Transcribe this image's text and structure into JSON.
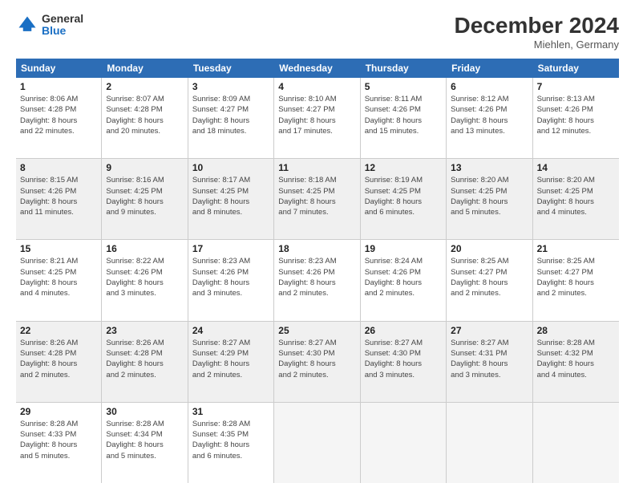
{
  "logo": {
    "general": "General",
    "blue": "Blue"
  },
  "header": {
    "month": "December 2024",
    "location": "Miehlen, Germany"
  },
  "weekdays": [
    "Sunday",
    "Monday",
    "Tuesday",
    "Wednesday",
    "Thursday",
    "Friday",
    "Saturday"
  ],
  "rows": [
    [
      {
        "day": "1",
        "lines": [
          "Sunrise: 8:06 AM",
          "Sunset: 4:28 PM",
          "Daylight: 8 hours",
          "and 22 minutes."
        ]
      },
      {
        "day": "2",
        "lines": [
          "Sunrise: 8:07 AM",
          "Sunset: 4:28 PM",
          "Daylight: 8 hours",
          "and 20 minutes."
        ]
      },
      {
        "day": "3",
        "lines": [
          "Sunrise: 8:09 AM",
          "Sunset: 4:27 PM",
          "Daylight: 8 hours",
          "and 18 minutes."
        ]
      },
      {
        "day": "4",
        "lines": [
          "Sunrise: 8:10 AM",
          "Sunset: 4:27 PM",
          "Daylight: 8 hours",
          "and 17 minutes."
        ]
      },
      {
        "day": "5",
        "lines": [
          "Sunrise: 8:11 AM",
          "Sunset: 4:26 PM",
          "Daylight: 8 hours",
          "and 15 minutes."
        ]
      },
      {
        "day": "6",
        "lines": [
          "Sunrise: 8:12 AM",
          "Sunset: 4:26 PM",
          "Daylight: 8 hours",
          "and 13 minutes."
        ]
      },
      {
        "day": "7",
        "lines": [
          "Sunrise: 8:13 AM",
          "Sunset: 4:26 PM",
          "Daylight: 8 hours",
          "and 12 minutes."
        ]
      }
    ],
    [
      {
        "day": "8",
        "lines": [
          "Sunrise: 8:15 AM",
          "Sunset: 4:26 PM",
          "Daylight: 8 hours",
          "and 11 minutes."
        ]
      },
      {
        "day": "9",
        "lines": [
          "Sunrise: 8:16 AM",
          "Sunset: 4:25 PM",
          "Daylight: 8 hours",
          "and 9 minutes."
        ]
      },
      {
        "day": "10",
        "lines": [
          "Sunrise: 8:17 AM",
          "Sunset: 4:25 PM",
          "Daylight: 8 hours",
          "and 8 minutes."
        ]
      },
      {
        "day": "11",
        "lines": [
          "Sunrise: 8:18 AM",
          "Sunset: 4:25 PM",
          "Daylight: 8 hours",
          "and 7 minutes."
        ]
      },
      {
        "day": "12",
        "lines": [
          "Sunrise: 8:19 AM",
          "Sunset: 4:25 PM",
          "Daylight: 8 hours",
          "and 6 minutes."
        ]
      },
      {
        "day": "13",
        "lines": [
          "Sunrise: 8:20 AM",
          "Sunset: 4:25 PM",
          "Daylight: 8 hours",
          "and 5 minutes."
        ]
      },
      {
        "day": "14",
        "lines": [
          "Sunrise: 8:20 AM",
          "Sunset: 4:25 PM",
          "Daylight: 8 hours",
          "and 4 minutes."
        ]
      }
    ],
    [
      {
        "day": "15",
        "lines": [
          "Sunrise: 8:21 AM",
          "Sunset: 4:25 PM",
          "Daylight: 8 hours",
          "and 4 minutes."
        ]
      },
      {
        "day": "16",
        "lines": [
          "Sunrise: 8:22 AM",
          "Sunset: 4:26 PM",
          "Daylight: 8 hours",
          "and 3 minutes."
        ]
      },
      {
        "day": "17",
        "lines": [
          "Sunrise: 8:23 AM",
          "Sunset: 4:26 PM",
          "Daylight: 8 hours",
          "and 3 minutes."
        ]
      },
      {
        "day": "18",
        "lines": [
          "Sunrise: 8:23 AM",
          "Sunset: 4:26 PM",
          "Daylight: 8 hours",
          "and 2 minutes."
        ]
      },
      {
        "day": "19",
        "lines": [
          "Sunrise: 8:24 AM",
          "Sunset: 4:26 PM",
          "Daylight: 8 hours",
          "and 2 minutes."
        ]
      },
      {
        "day": "20",
        "lines": [
          "Sunrise: 8:25 AM",
          "Sunset: 4:27 PM",
          "Daylight: 8 hours",
          "and 2 minutes."
        ]
      },
      {
        "day": "21",
        "lines": [
          "Sunrise: 8:25 AM",
          "Sunset: 4:27 PM",
          "Daylight: 8 hours",
          "and 2 minutes."
        ]
      }
    ],
    [
      {
        "day": "22",
        "lines": [
          "Sunrise: 8:26 AM",
          "Sunset: 4:28 PM",
          "Daylight: 8 hours",
          "and 2 minutes."
        ]
      },
      {
        "day": "23",
        "lines": [
          "Sunrise: 8:26 AM",
          "Sunset: 4:28 PM",
          "Daylight: 8 hours",
          "and 2 minutes."
        ]
      },
      {
        "day": "24",
        "lines": [
          "Sunrise: 8:27 AM",
          "Sunset: 4:29 PM",
          "Daylight: 8 hours",
          "and 2 minutes."
        ]
      },
      {
        "day": "25",
        "lines": [
          "Sunrise: 8:27 AM",
          "Sunset: 4:30 PM",
          "Daylight: 8 hours",
          "and 2 minutes."
        ]
      },
      {
        "day": "26",
        "lines": [
          "Sunrise: 8:27 AM",
          "Sunset: 4:30 PM",
          "Daylight: 8 hours",
          "and 3 minutes."
        ]
      },
      {
        "day": "27",
        "lines": [
          "Sunrise: 8:27 AM",
          "Sunset: 4:31 PM",
          "Daylight: 8 hours",
          "and 3 minutes."
        ]
      },
      {
        "day": "28",
        "lines": [
          "Sunrise: 8:28 AM",
          "Sunset: 4:32 PM",
          "Daylight: 8 hours",
          "and 4 minutes."
        ]
      }
    ],
    [
      {
        "day": "29",
        "lines": [
          "Sunrise: 8:28 AM",
          "Sunset: 4:33 PM",
          "Daylight: 8 hours",
          "and 5 minutes."
        ]
      },
      {
        "day": "30",
        "lines": [
          "Sunrise: 8:28 AM",
          "Sunset: 4:34 PM",
          "Daylight: 8 hours",
          "and 5 minutes."
        ]
      },
      {
        "day": "31",
        "lines": [
          "Sunrise: 8:28 AM",
          "Sunset: 4:35 PM",
          "Daylight: 8 hours",
          "and 6 minutes."
        ]
      },
      {
        "day": "",
        "lines": []
      },
      {
        "day": "",
        "lines": []
      },
      {
        "day": "",
        "lines": []
      },
      {
        "day": "",
        "lines": []
      }
    ]
  ]
}
